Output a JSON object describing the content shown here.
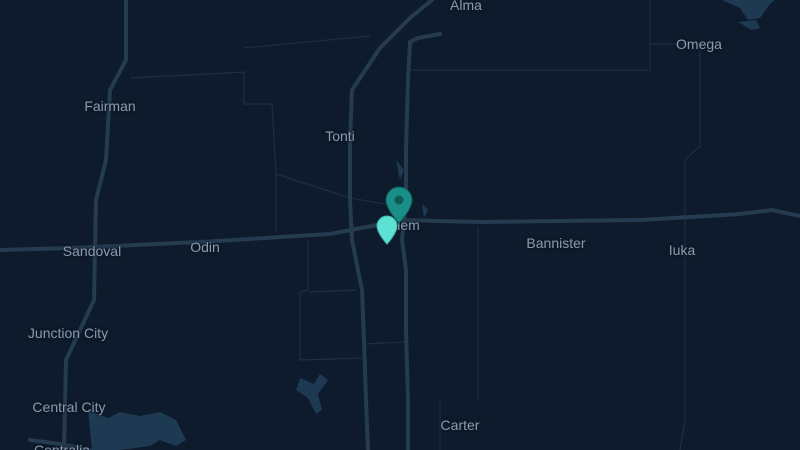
{
  "map": {
    "theme": "dark",
    "colors": {
      "background": "#0e1b2c",
      "major_road": "#253b4f",
      "minor_road": "#1f3346",
      "water": "#1d3a52",
      "label": "#8b9aab",
      "pin_selected": "#1a8f87",
      "pin_secondary": "#5ee0d3"
    },
    "places": [
      {
        "id": "alma",
        "name": "Alma"
      },
      {
        "id": "omega",
        "name": "Omega"
      },
      {
        "id": "fairman",
        "name": "Fairman"
      },
      {
        "id": "tonti",
        "name": "Tonti"
      },
      {
        "id": "salem",
        "name": "Salem"
      },
      {
        "id": "sandoval",
        "name": "Sandoval"
      },
      {
        "id": "odin",
        "name": "Odin"
      },
      {
        "id": "bannister",
        "name": "Bannister"
      },
      {
        "id": "iuka",
        "name": "Iuka"
      },
      {
        "id": "junction-city",
        "name": "Junction City"
      },
      {
        "id": "central-city",
        "name": "Central City"
      },
      {
        "id": "carter",
        "name": "Carter"
      },
      {
        "id": "centralia",
        "name": "Centralia"
      }
    ],
    "markers": [
      {
        "id": "primary",
        "icon": "map-pin-icon",
        "color": "#1a8f87"
      },
      {
        "id": "secondary",
        "icon": "map-pin-icon",
        "color": "#5ee0d3"
      }
    ]
  }
}
